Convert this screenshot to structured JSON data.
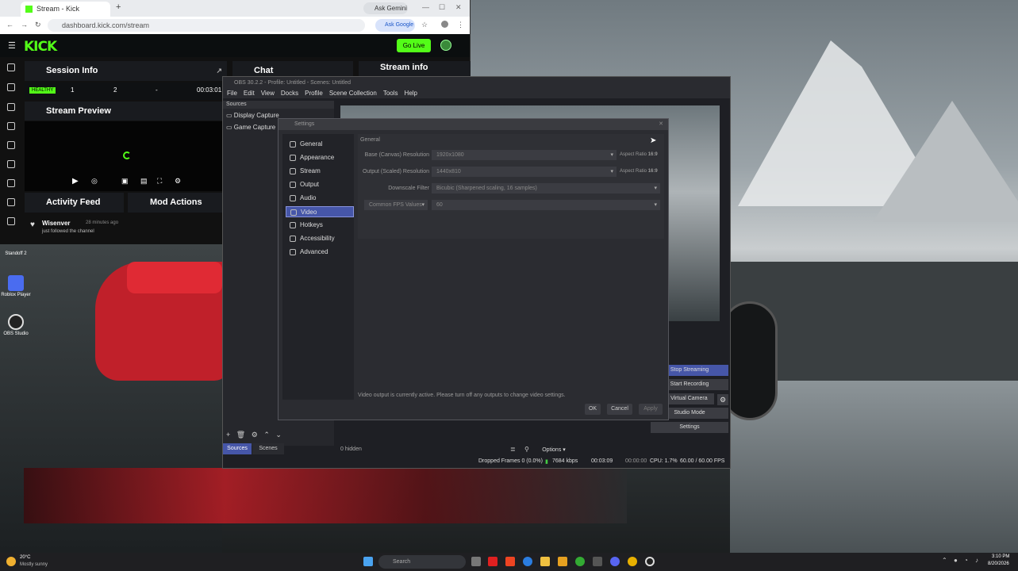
{
  "browser": {
    "tab_title": "Stream - Kick Dashboard",
    "tab2": "Ask Gemini",
    "url": "dashboard.kick.com/stream",
    "ask_google": "Ask Google",
    "logo": "KICK",
    "go_live": "Go Live",
    "session_info": "Session Info",
    "chat": "Chat",
    "stream_info": "Stream info",
    "healthy": "HEALTHY",
    "stat1": "1",
    "stat2": "2",
    "stat3": "-",
    "timer": "00:03:01",
    "stream_preview": "Stream Preview",
    "activity_feed": "Activity Feed",
    "mod_actions": "Mod Actions",
    "follower_name": "Wisenver",
    "follower_time": "28 minutes ago",
    "follower_msg": "just followed the channel"
  },
  "obs": {
    "title": "OBS 30.2.2 - Profile: Untitled - Scenes: Untitled",
    "menu": [
      "File",
      "Edit",
      "View",
      "Docks",
      "Profile",
      "Scene Collection",
      "Tools",
      "Help"
    ],
    "sources_header": "Sources",
    "sources": [
      "Display Capture",
      "Game Capture"
    ],
    "tab_sources": "Sources",
    "tab_scenes": "Scenes",
    "hidden": "0 hidden",
    "options": "Options",
    "controls": [
      "Stop Streaming",
      "Start Recording",
      "Start Virtual Camera",
      "Studio Mode",
      "Settings"
    ],
    "status_dropped": "Dropped Frames 0 (0.0%)",
    "status_kbps": "7684 kbps",
    "status_stream_time": "00:03:09",
    "status_rec_time": "00:00:00",
    "status_cpu": "CPU: 1.7%",
    "status_fps": "60.00 / 60.00 FPS"
  },
  "settings": {
    "title": "Settings",
    "nav": [
      "General",
      "Appearance",
      "Stream",
      "Output",
      "Audio",
      "Video",
      "Hotkeys",
      "Accessibility",
      "Advanced"
    ],
    "selected": "Video",
    "section": "General",
    "base_label": "Base (Canvas) Resolution",
    "base_value": "1920x1080",
    "output_label": "Output (Scaled) Resolution",
    "output_value": "1440x810",
    "aspect_label": "Aspect Ratio",
    "aspect_value": "16:9",
    "downscale_label": "Downscale Filter",
    "downscale_value": "Bicubic (Sharpened scaling, 16 samples)",
    "fps_label": "Common FPS Values",
    "fps_value": "60",
    "notice": "Video output is currently active. Please turn off any outputs to change video settings.",
    "ok": "OK",
    "cancel": "Cancel",
    "apply": "Apply"
  },
  "desktop": {
    "icons": [
      "Standoff 2",
      "Roblox Player",
      "OBS Studio"
    ]
  },
  "taskbar": {
    "weather_temp": "20°C",
    "weather_desc": "Mostly sunny",
    "search": "Search",
    "time": "3:10 PM",
    "date": "8/20/2026"
  }
}
